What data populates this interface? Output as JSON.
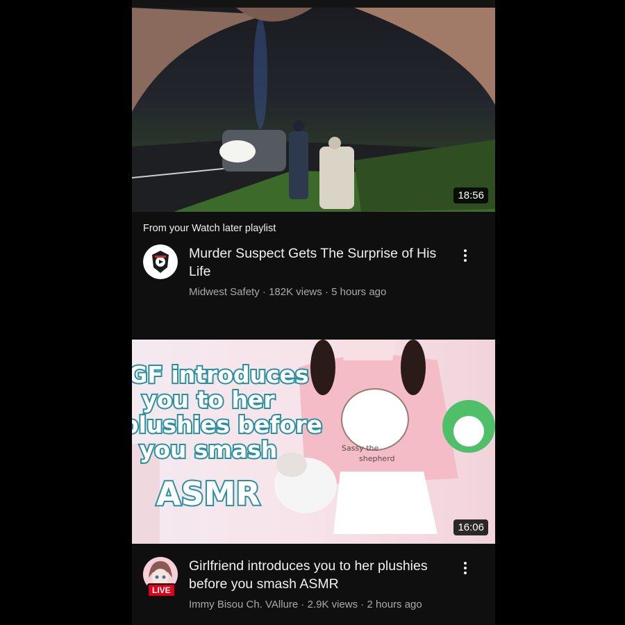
{
  "videos": [
    {
      "duration": "18:56",
      "context": "From your Watch later playlist",
      "title": "Murder Suspect Gets The Surprise of His Life",
      "channel": "Midwest Safety",
      "views": "182K views",
      "age": "5 hours ago",
      "separator": " · ",
      "avatar_icon": "police-badge-icon"
    },
    {
      "duration": "16:06",
      "title": "Girlfriend introduces you to her plushies before you smash ASMR",
      "channel": "Immy Bisou Ch. VAllure",
      "views": "2.9K views",
      "age": "2 hours ago",
      "separator": " · ",
      "live_badge": "LIVE",
      "thumbnail_text": {
        "line1": "GF introduces",
        "line2": "you to her",
        "line3": "plushies before",
        "line4": "you smash",
        "line5": "ASMR"
      },
      "sweater_text": {
        "line1": "Sassy the",
        "line2": "shepherd"
      }
    }
  ],
  "colors": {
    "background": "#0f0f0f",
    "title": "#f1f1f1",
    "subtitle": "#aaaaaa",
    "live": "#e0001a",
    "thumb_text_fill": "#ffffff",
    "thumb_text_stroke": "#2a8fa0"
  }
}
